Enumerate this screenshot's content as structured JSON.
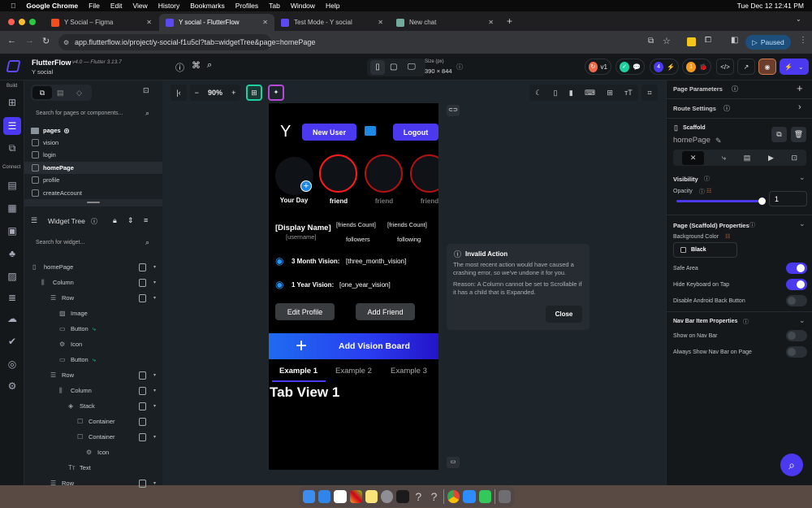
{
  "menubar": {
    "app": "Google Chrome",
    "items": [
      "File",
      "Edit",
      "View",
      "History",
      "Bookmarks",
      "Profiles",
      "Tab",
      "Window",
      "Help"
    ],
    "clock": "Tue Dec 12  12:41 PM"
  },
  "tabs": [
    {
      "title": "Y Social – Figma"
    },
    {
      "title": "Y social - FlutterFlow",
      "active": true
    },
    {
      "title": "Test Mode - Y social"
    },
    {
      "title": "New chat"
    }
  ],
  "address": {
    "url": "app.flutterflow.io/project/y-social-f1u5cl?tab=widgetTree&page=homePage",
    "profile_label": "Paused"
  },
  "ffbar": {
    "brand": "FlutterFlow",
    "version": "v4.0 — Flutter 3.13.7",
    "project": "Y social",
    "size_label": "Size (px)",
    "size_value": "390 × 844",
    "version_badge": "v1",
    "tasks_count": "4",
    "issues_count": "1"
  },
  "rail": {
    "build_label": "Build",
    "connect_label": "Connect"
  },
  "pages": {
    "search_placeholder": "Search for pages or components...",
    "folder": "pages",
    "items": [
      "vision",
      "login",
      "homePage",
      "profile",
      "createAccount"
    ],
    "selected": "homePage"
  },
  "widget_tree": {
    "title": "Widget Tree",
    "search_placeholder": "Search for widget...",
    "nodes": [
      {
        "label": "homePage",
        "depth": 0
      },
      {
        "label": "Column",
        "depth": 1
      },
      {
        "label": "Row",
        "depth": 2
      },
      {
        "label": "Image",
        "depth": 3
      },
      {
        "label": "Button",
        "depth": 3,
        "action": true
      },
      {
        "label": "Icon",
        "depth": 3
      },
      {
        "label": "Button",
        "depth": 3,
        "action": true
      },
      {
        "label": "Row",
        "depth": 2
      },
      {
        "label": "Column",
        "depth": 3
      },
      {
        "label": "Stack",
        "depth": 4
      },
      {
        "label": "Container",
        "depth": 5
      },
      {
        "label": "Container",
        "depth": 5
      },
      {
        "label": "Icon",
        "depth": 6
      },
      {
        "label": "Text",
        "depth": 4
      },
      {
        "label": "Row",
        "depth": 2
      }
    ]
  },
  "canvas": {
    "zoom": "90%"
  },
  "phone": {
    "logo": "Y",
    "new_user": "New User",
    "logout": "Logout",
    "stories": [
      "Your Day",
      "friend",
      "friend",
      "friend"
    ],
    "display_name": "[Display Name]",
    "username": "[username]",
    "friends_count_1": "[friends Count]",
    "followers": "followers",
    "friends_count_2": "[friends Count]",
    "following": "following",
    "vision3_label": "3 Month Vision:",
    "vision3_value": "[three_month_vision]",
    "vision1_label": "1 Year Vision:",
    "vision1_value": "[one_year_vision]",
    "edit_profile": "Edit Profile",
    "add_friend": "Add Friend",
    "add_vision": "Add Vision Board",
    "tabs": [
      "Example 1",
      "Example 2",
      "Example 3"
    ],
    "tab_view": "Tab View 1"
  },
  "toast": {
    "title": "Invalid Action",
    "line1": "The most recent action would have caused a crashing error, so we've undone it for you.",
    "line2": "Reason: A Column cannot be set to Scrollable if it has a child that is Expanded.",
    "close": "Close"
  },
  "props": {
    "page_parameters": "Page Parameters",
    "route_settings": "Route Settings",
    "widget_type": "Scaffold",
    "widget_name": "homePage",
    "visibility": "Visibility",
    "opacity_label": "Opacity",
    "opacity_value": "1",
    "opacity": 1,
    "scaffold_props": "Page (Scaffold) Properties",
    "bg_color_label": "Background Color",
    "bg_color": "Black",
    "safe_area": "Safe Area",
    "safe_area_on": true,
    "hide_kb": "Hide Keyboard on Tap",
    "hide_kb_on": true,
    "disable_back": "Disable Android Back Button",
    "disable_back_on": false,
    "nav_props": "Nav Bar Item Properties",
    "show_nav": "Show on Nav Bar",
    "show_nav_on": false,
    "always_nav": "Always Show Nav Bar on Page",
    "always_nav_on": false
  },
  "colors": {
    "accent": "#4b39ef",
    "story_ring": "#ff1a1a",
    "action": "#1ecfa0",
    "canvas": "#1e252a"
  }
}
